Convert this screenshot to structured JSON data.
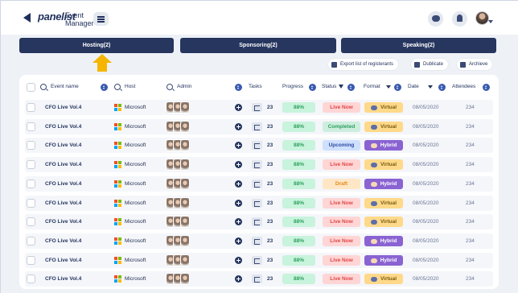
{
  "header": {
    "logo_main": "panelist",
    "logo_sub_line1": "Event",
    "logo_sub_line2": "Manager"
  },
  "tabs": [
    {
      "label": "Hosting(2)"
    },
    {
      "label": "Sponsoring(2)"
    },
    {
      "label": "Speaking(2)"
    }
  ],
  "actions": {
    "export_label": "Export list of registerants",
    "duplicate_label": "Dublicate",
    "archive_label": "Archieve"
  },
  "columns": {
    "event_name": "Event name",
    "host": "Host",
    "admin": "Admin",
    "tasks": "Tasks",
    "progress": "Progress",
    "status": "Status",
    "format": "Format",
    "date": "Date",
    "attendees": "Attendees"
  },
  "colors": {
    "tab_bg": "#26365f",
    "accent_arrow": "#f5b500",
    "progress_bg": "#c8f3dc",
    "progress_text": "#2d9f5e",
    "live_bg": "#ffd5d5",
    "live_text": "#e04646",
    "completed_bg": "#cdeede",
    "completed_text": "#2d9f5e",
    "upcoming_bg": "#cfe0ff",
    "upcoming_text": "#2b4a9e",
    "draft_bg": "#ffe6c4",
    "draft_text": "#e38a1f",
    "virtual_bg": "#ffd98a",
    "virtual_text": "#7a5a10",
    "hybrid_bg": "#8a63d2",
    "hybrid_text": "#ffffff"
  },
  "rows": [
    {
      "name": "CFO Live Vol.4",
      "host": "Microsoft",
      "tasks": "23",
      "progress": "88%",
      "status": "Live Now",
      "status_kind": "live",
      "format": "Virtual",
      "format_kind": "virtual",
      "date": "08/05/2020",
      "attendees": "234"
    },
    {
      "name": "CFO Live Vol.4",
      "host": "Microsoft",
      "tasks": "23",
      "progress": "88%",
      "status": "Completed",
      "status_kind": "completed",
      "format": "Virtual",
      "format_kind": "virtual",
      "date": "08/05/2020",
      "attendees": "234"
    },
    {
      "name": "CFO Live Vol.4",
      "host": "Microsoft",
      "tasks": "23",
      "progress": "88%",
      "status": "Upcoming",
      "status_kind": "upcoming",
      "format": "Hybrid",
      "format_kind": "hybrid",
      "date": "08/05/2020",
      "attendees": "234"
    },
    {
      "name": "CFO Live Vol.4",
      "host": "Microsoft",
      "tasks": "23",
      "progress": "88%",
      "status": "Live Now",
      "status_kind": "live",
      "format": "Virtual",
      "format_kind": "virtual",
      "date": "08/05/2020",
      "attendees": "234"
    },
    {
      "name": "CFO Live Vol.4",
      "host": "Microsoft",
      "tasks": "23",
      "progress": "88%",
      "status": "Draft",
      "status_kind": "draft",
      "format": "Hybrid",
      "format_kind": "hybrid",
      "date": "08/05/2020",
      "attendees": "234"
    },
    {
      "name": "CFO Live Vol.4",
      "host": "Microsoft",
      "tasks": "23",
      "progress": "88%",
      "status": "Live Now",
      "status_kind": "live",
      "format": "Virtual",
      "format_kind": "virtual",
      "date": "08/05/2020",
      "attendees": "234"
    },
    {
      "name": "CFO Live Vol.4",
      "host": "Microsoft",
      "tasks": "23",
      "progress": "88%",
      "status": "Live Now",
      "status_kind": "live",
      "format": "Virtual",
      "format_kind": "virtual",
      "date": "08/05/2020",
      "attendees": "234"
    },
    {
      "name": "CFO Live Vol.4",
      "host": "Microsoft",
      "tasks": "23",
      "progress": "88%",
      "status": "Live Now",
      "status_kind": "live",
      "format": "Hybrid",
      "format_kind": "hybrid",
      "date": "08/05/2020",
      "attendees": "234"
    },
    {
      "name": "CFO Live Vol.4",
      "host": "Microsoft",
      "tasks": "23",
      "progress": "88%",
      "status": "Live Now",
      "status_kind": "live",
      "format": "Hybrid",
      "format_kind": "hybrid",
      "date": "08/05/2020",
      "attendees": "234"
    },
    {
      "name": "CFO Live Vol.4",
      "host": "Microsoft",
      "tasks": "23",
      "progress": "88%",
      "status": "Live Now",
      "status_kind": "live",
      "format": "Virtual",
      "format_kind": "virtual",
      "date": "08/05/2020",
      "attendees": "234"
    }
  ]
}
